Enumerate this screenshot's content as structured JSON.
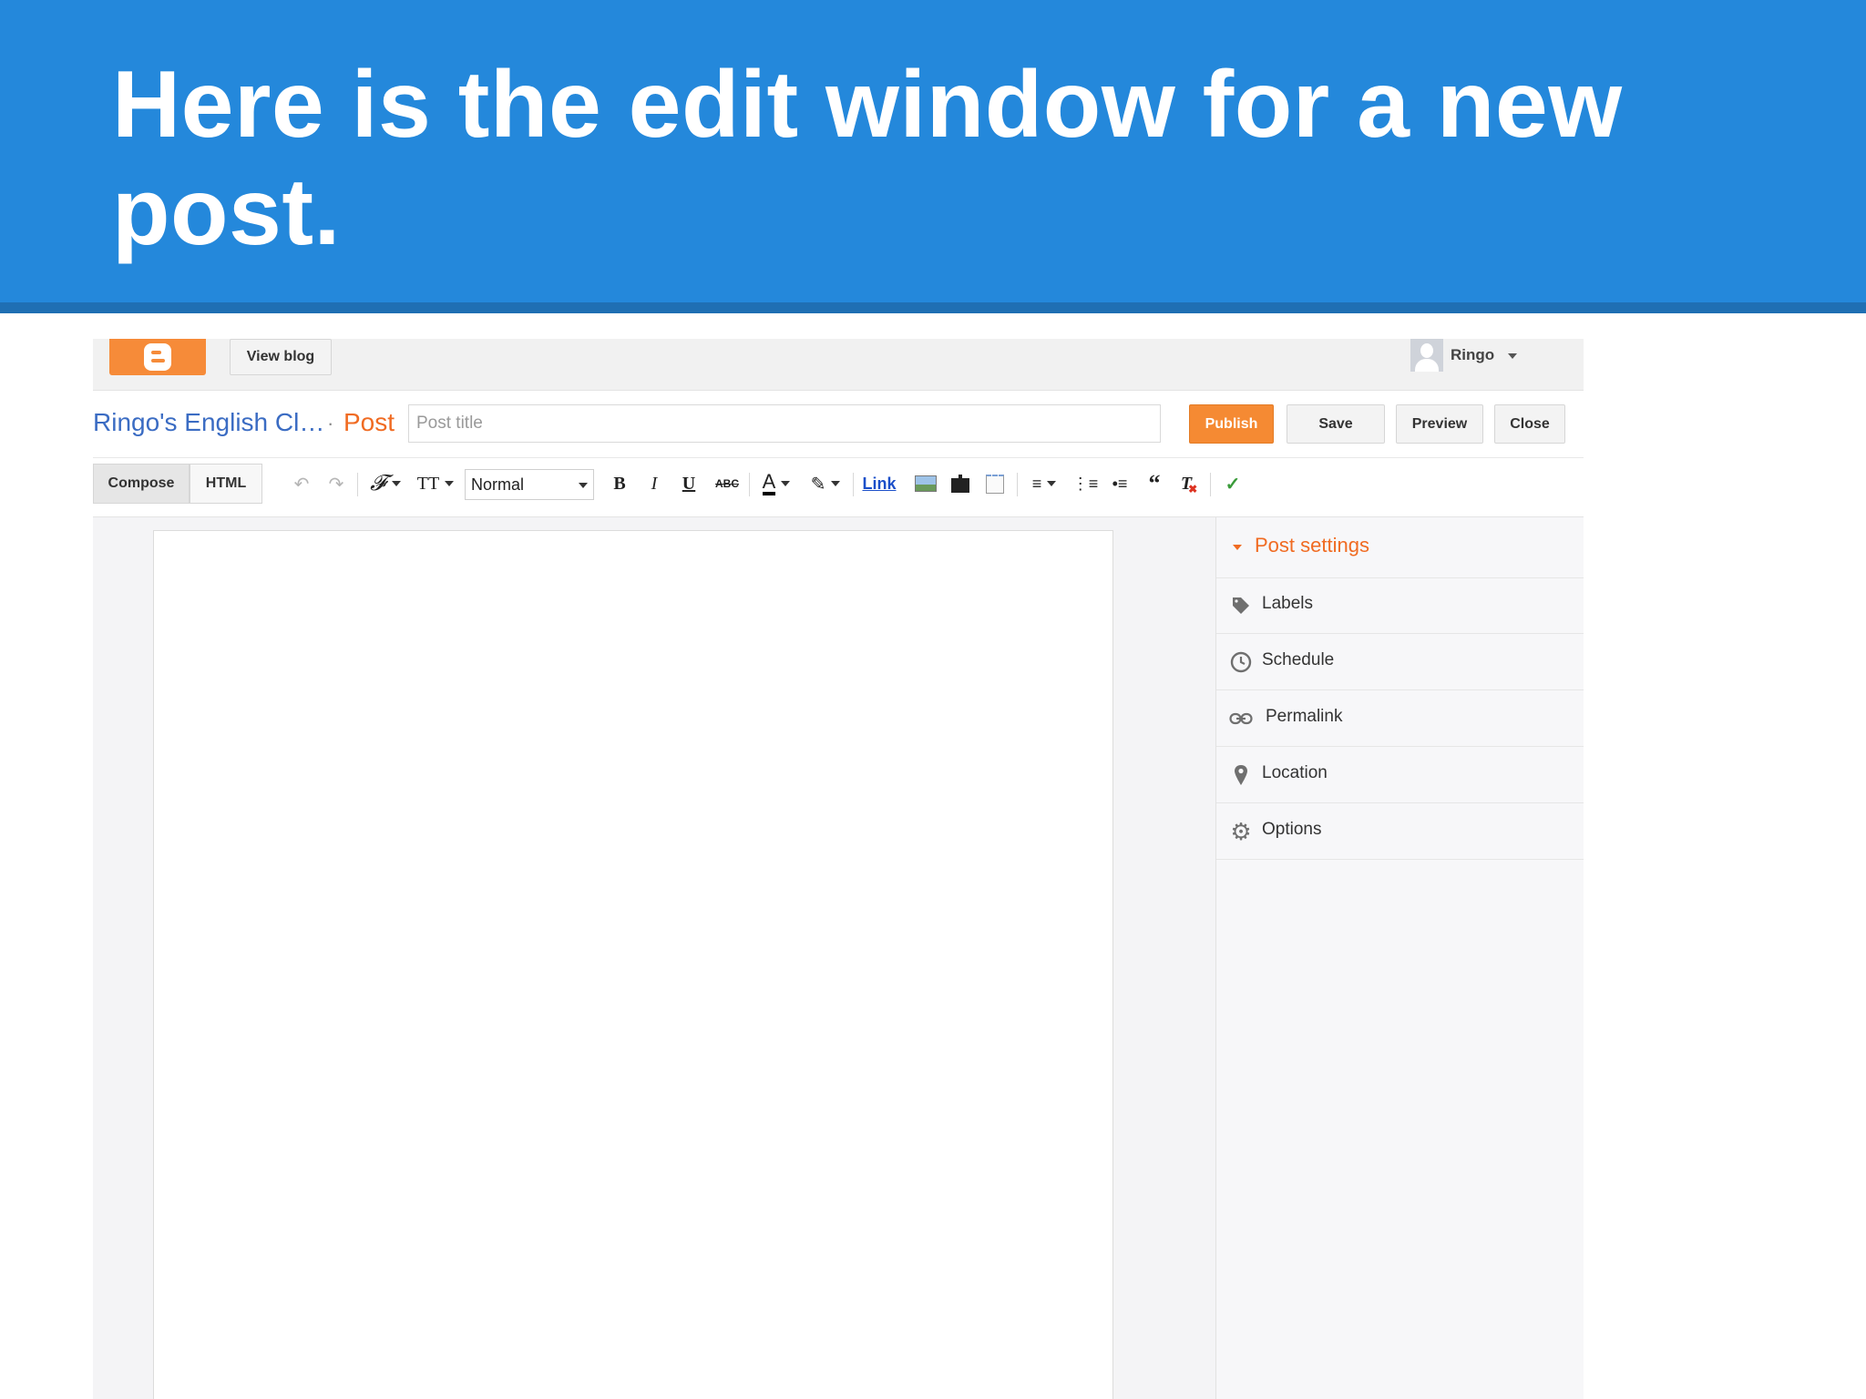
{
  "slide": {
    "heading": "Here is the edit window for a new post."
  },
  "topbar": {
    "view_blog": "View blog",
    "username": "Ringo"
  },
  "post_header": {
    "blog_name": "Ringo's English Cl…",
    "separator": "·",
    "post_type": "Post",
    "title_placeholder": "Post title",
    "publish": "Publish",
    "save": "Save",
    "preview": "Preview",
    "close": "Close"
  },
  "toolbar": {
    "compose": "Compose",
    "html": "HTML",
    "format_value": "Normal",
    "link": "Link"
  },
  "post_settings": {
    "title": "Post settings",
    "items": [
      {
        "label": "Labels",
        "icon": "tag-icon"
      },
      {
        "label": "Schedule",
        "icon": "clock-icon"
      },
      {
        "label": "Permalink",
        "icon": "link-icon"
      },
      {
        "label": "Location",
        "icon": "pin-icon"
      },
      {
        "label": "Options",
        "icon": "gear-icon"
      }
    ]
  },
  "colors": {
    "banner": "#2488db",
    "publish": "#f58a33",
    "accent_orange": "#f06b22",
    "blog_blue": "#3b6cc3"
  }
}
